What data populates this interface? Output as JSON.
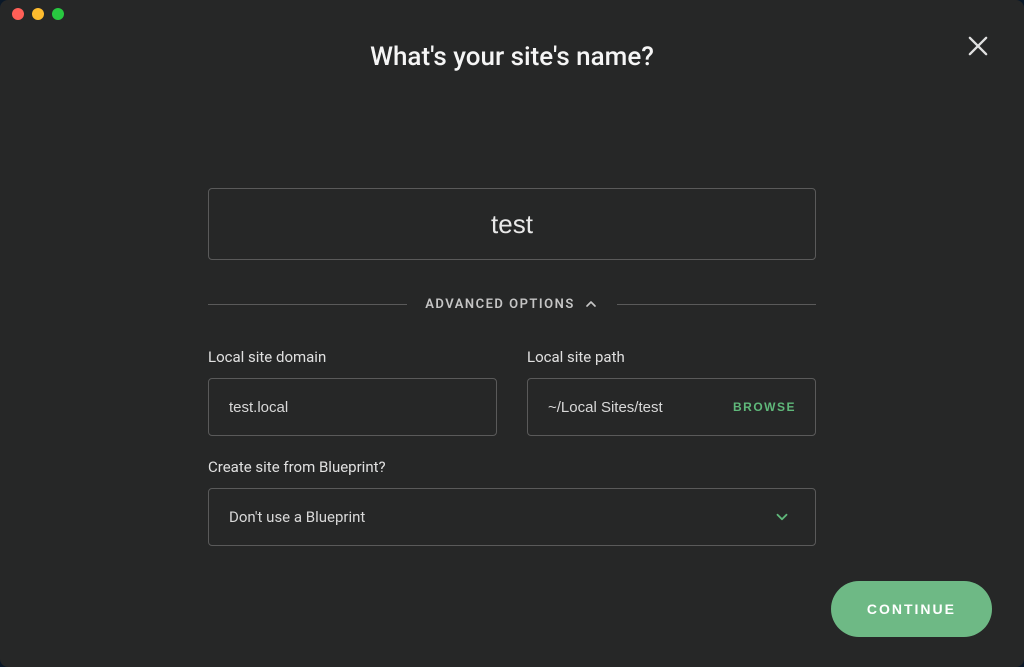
{
  "title": "What's your site's name?",
  "site_name": {
    "value": "test"
  },
  "advanced": {
    "toggle_label": "ADVANCED OPTIONS",
    "domain": {
      "label": "Local site domain",
      "value": "test.local"
    },
    "path": {
      "label": "Local site path",
      "value": "~/Local Sites/test",
      "browse_label": "BROWSE"
    },
    "blueprint": {
      "label": "Create site from Blueprint?",
      "selected": "Don't use a Blueprint"
    }
  },
  "buttons": {
    "continue": "CONTINUE"
  }
}
